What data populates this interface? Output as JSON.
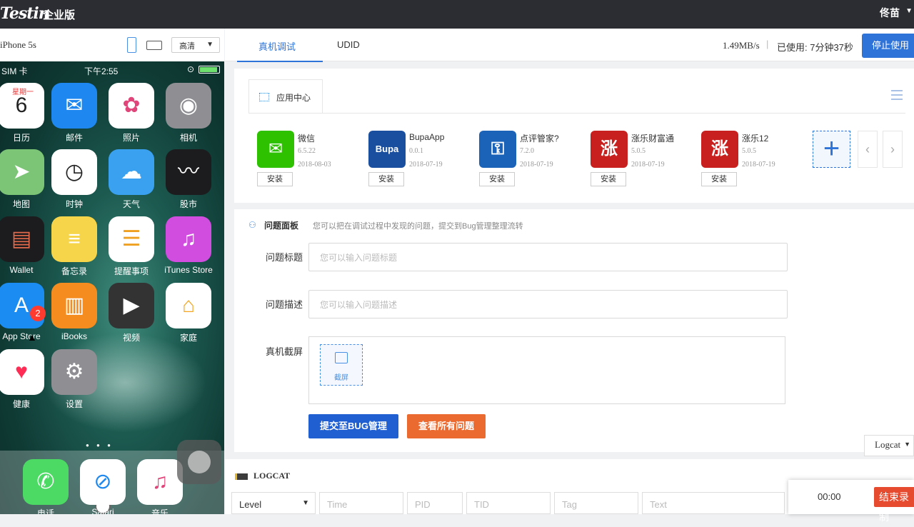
{
  "header": {
    "logo": "Testin",
    "edition": "企业版",
    "user": "佟苗"
  },
  "device": {
    "name": "iPhone 5s",
    "quality": "高清"
  },
  "phone": {
    "status_left": "SIM 卡",
    "time": "下午2:55",
    "apps": [
      {
        "label": "日历",
        "glyph": "6"
      },
      {
        "label": "邮件",
        "glyph": "✉"
      },
      {
        "label": "照片",
        "glyph": "✿"
      },
      {
        "label": "相机",
        "glyph": "◉"
      },
      {
        "label": "地图",
        "glyph": "➤"
      },
      {
        "label": "时钟",
        "glyph": "◷"
      },
      {
        "label": "天气",
        "glyph": "☁"
      },
      {
        "label": "股市",
        "glyph": "〰"
      },
      {
        "label": "Wallet",
        "glyph": "▤"
      },
      {
        "label": "备忘录",
        "glyph": "≡"
      },
      {
        "label": "提醒事项",
        "glyph": "☰"
      },
      {
        "label": "iTunes Store",
        "glyph": "♫"
      },
      {
        "label": "App Store",
        "glyph": "A"
      },
      {
        "label": "iBooks",
        "glyph": "▥"
      },
      {
        "label": "视频",
        "glyph": "▶"
      },
      {
        "label": "家庭",
        "glyph": "⌂"
      },
      {
        "label": "健康",
        "glyph": "♥"
      },
      {
        "label": "设置",
        "glyph": "⚙"
      }
    ],
    "dock": [
      {
        "label": "电话",
        "glyph": "✆"
      },
      {
        "label": "Safari",
        "glyph": "⊘"
      },
      {
        "label": "音乐",
        "glyph": "♫"
      }
    ],
    "calendar_day": "星期一",
    "badge": "2"
  },
  "tabs": {
    "debug": "真机调试",
    "udid": "UDID"
  },
  "stats": {
    "speed": "1.49MB/s",
    "used": "已使用: 7分钟37秒",
    "stop": "停止使用"
  },
  "app_center": {
    "tab": "应用中心",
    "install_label": "安装",
    "apps": [
      {
        "name": "微信",
        "version": "6.5.22",
        "date": "2018-08-03",
        "glyph": "✉",
        "color": "#2dc100"
      },
      {
        "name": "BupaApp",
        "version": "0.0.1",
        "date": "2018-07-19",
        "glyph": "Bupa",
        "color": "#1a4fa0"
      },
      {
        "name": "点评管家?",
        "version": "7.2.0",
        "date": "2018-07-19",
        "glyph": "⚿",
        "color": "#1b63b8"
      },
      {
        "name": "涨乐财富通",
        "version": "5.0.5",
        "date": "2018-07-19",
        "glyph": "涨",
        "color": "#c8201e"
      },
      {
        "name": "涨乐12",
        "version": "5.0.5",
        "date": "2018-07-19",
        "glyph": "涨",
        "color": "#c8201e"
      }
    ],
    "add": "+",
    "prev": "‹",
    "next": "›"
  },
  "issues": {
    "title": "问题面板",
    "desc": "您可以把在调试过程中发现的问题，提交到Bug管理整理流转",
    "title_label": "问题标题",
    "title_placeholder": "您可以输入问题标题",
    "desc_label": "问题描述",
    "desc_placeholder": "您可以输入问题描述",
    "shot_label": "真机截屏",
    "shot_button": "截屏",
    "submit": "提交至BUG管理",
    "view_all": "查看所有问题"
  },
  "logcat": {
    "dropdown": "Logcat",
    "title": "LOGCAT",
    "level": "Level",
    "time": "Time",
    "pid": "PID",
    "tid": "TID",
    "tag": "Tag",
    "text": "Text"
  },
  "recording": {
    "time": "00:00",
    "end": "结束录制"
  }
}
